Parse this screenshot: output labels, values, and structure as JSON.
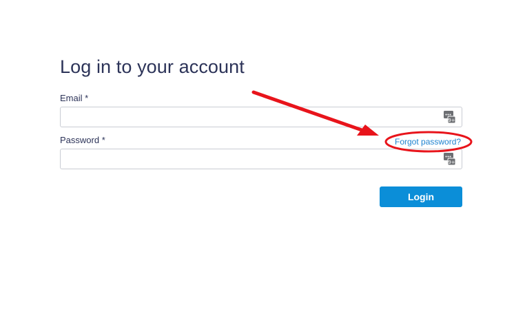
{
  "form": {
    "title": "Log in to your account",
    "email_label": "Email *",
    "email_value": "",
    "password_label": "Password *",
    "password_value": "",
    "forgot_link": "Forgot password?",
    "login_button": "Login"
  },
  "icons": {
    "email_field_icon": "password-manager-key-icon",
    "password_field_icon": "password-manager-key-icon"
  },
  "annotation": {
    "color": "#e8141b",
    "shapes": [
      "arrow",
      "ellipse"
    ]
  },
  "colors": {
    "title": "#2c3358",
    "link": "#1e83d0",
    "button": "#0b8ed8",
    "input_border": "#c9ccd3"
  }
}
